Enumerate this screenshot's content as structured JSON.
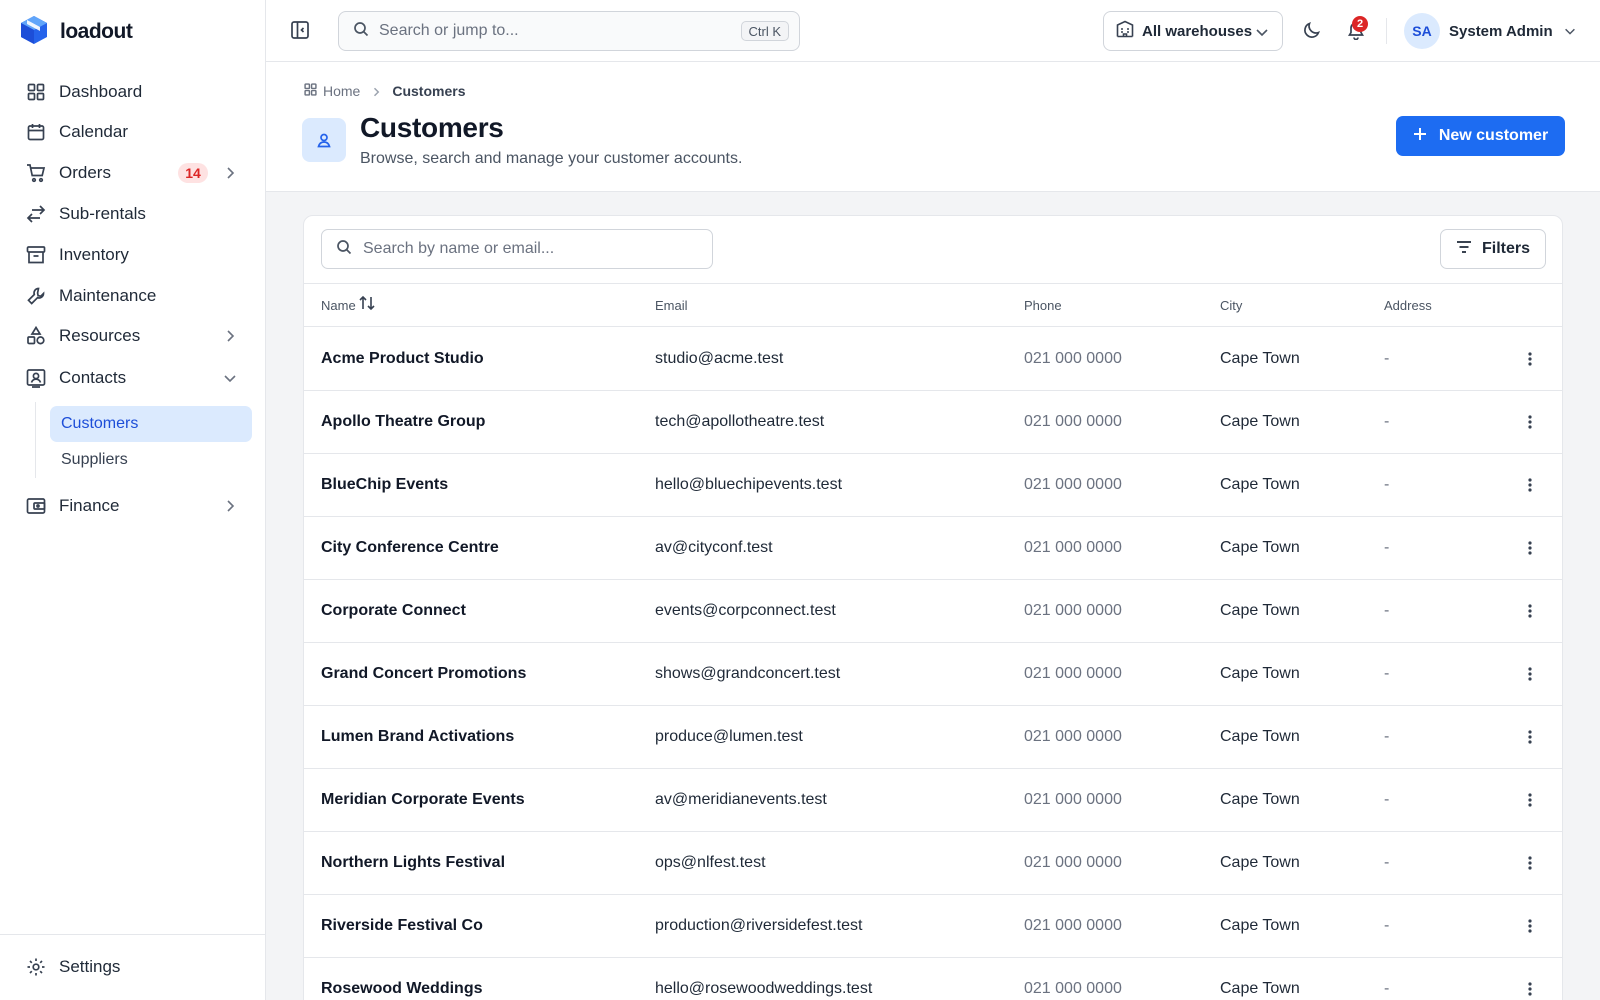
{
  "app": {
    "name": "loadout"
  },
  "sidebar": {
    "items": [
      {
        "label": "Dashboard"
      },
      {
        "label": "Calendar"
      },
      {
        "label": "Orders",
        "badge": "14"
      },
      {
        "label": "Sub-rentals"
      },
      {
        "label": "Inventory"
      },
      {
        "label": "Maintenance"
      },
      {
        "label": "Resources"
      },
      {
        "label": "Contacts"
      },
      {
        "label": "Finance"
      }
    ],
    "contacts_children": [
      {
        "label": "Customers",
        "active": true
      },
      {
        "label": "Suppliers"
      }
    ],
    "settings_label": "Settings"
  },
  "topbar": {
    "search_placeholder": "Search or jump to...",
    "search_shortcut": "Ctrl K",
    "warehouse": "All warehouses",
    "notifications_count": "2",
    "user": {
      "initials": "SA",
      "name": "System Admin"
    }
  },
  "breadcrumb": {
    "home": "Home",
    "current": "Customers"
  },
  "page": {
    "title": "Customers",
    "subtitle": "Browse, search and manage your customer accounts.",
    "new_button": "New customer"
  },
  "table": {
    "search_placeholder": "Search by name or email...",
    "filters_label": "Filters",
    "columns": [
      "Name",
      "Email",
      "Phone",
      "City",
      "Address"
    ],
    "rows": [
      {
        "name": "Acme Product Studio",
        "email": "studio@acme.test",
        "phone": "021 000 0000",
        "city": "Cape Town",
        "address": "-"
      },
      {
        "name": "Apollo Theatre Group",
        "email": "tech@apollotheatre.test",
        "phone": "021 000 0000",
        "city": "Cape Town",
        "address": "-"
      },
      {
        "name": "BlueChip Events",
        "email": "hello@bluechipevents.test",
        "phone": "021 000 0000",
        "city": "Cape Town",
        "address": "-"
      },
      {
        "name": "City Conference Centre",
        "email": "av@cityconf.test",
        "phone": "021 000 0000",
        "city": "Cape Town",
        "address": "-"
      },
      {
        "name": "Corporate Connect",
        "email": "events@corpconnect.test",
        "phone": "021 000 0000",
        "city": "Cape Town",
        "address": "-"
      },
      {
        "name": "Grand Concert Promotions",
        "email": "shows@grandconcert.test",
        "phone": "021 000 0000",
        "city": "Cape Town",
        "address": "-"
      },
      {
        "name": "Lumen Brand Activations",
        "email": "produce@lumen.test",
        "phone": "021 000 0000",
        "city": "Cape Town",
        "address": "-"
      },
      {
        "name": "Meridian Corporate Events",
        "email": "av@meridianevents.test",
        "phone": "021 000 0000",
        "city": "Cape Town",
        "address": "-"
      },
      {
        "name": "Northern Lights Festival",
        "email": "ops@nlfest.test",
        "phone": "021 000 0000",
        "city": "Cape Town",
        "address": "-"
      },
      {
        "name": "Riverside Festival Co",
        "email": "production@riversidefest.test",
        "phone": "021 000 0000",
        "city": "Cape Town",
        "address": "-"
      },
      {
        "name": "Rosewood Weddings",
        "email": "hello@rosewoodweddings.test",
        "phone": "021 000 0000",
        "city": "Cape Town",
        "address": "-"
      }
    ]
  },
  "colors": {
    "accent": "#1d6cf2",
    "active_bg": "#dbeafe",
    "badge_red": "#dc2626"
  }
}
